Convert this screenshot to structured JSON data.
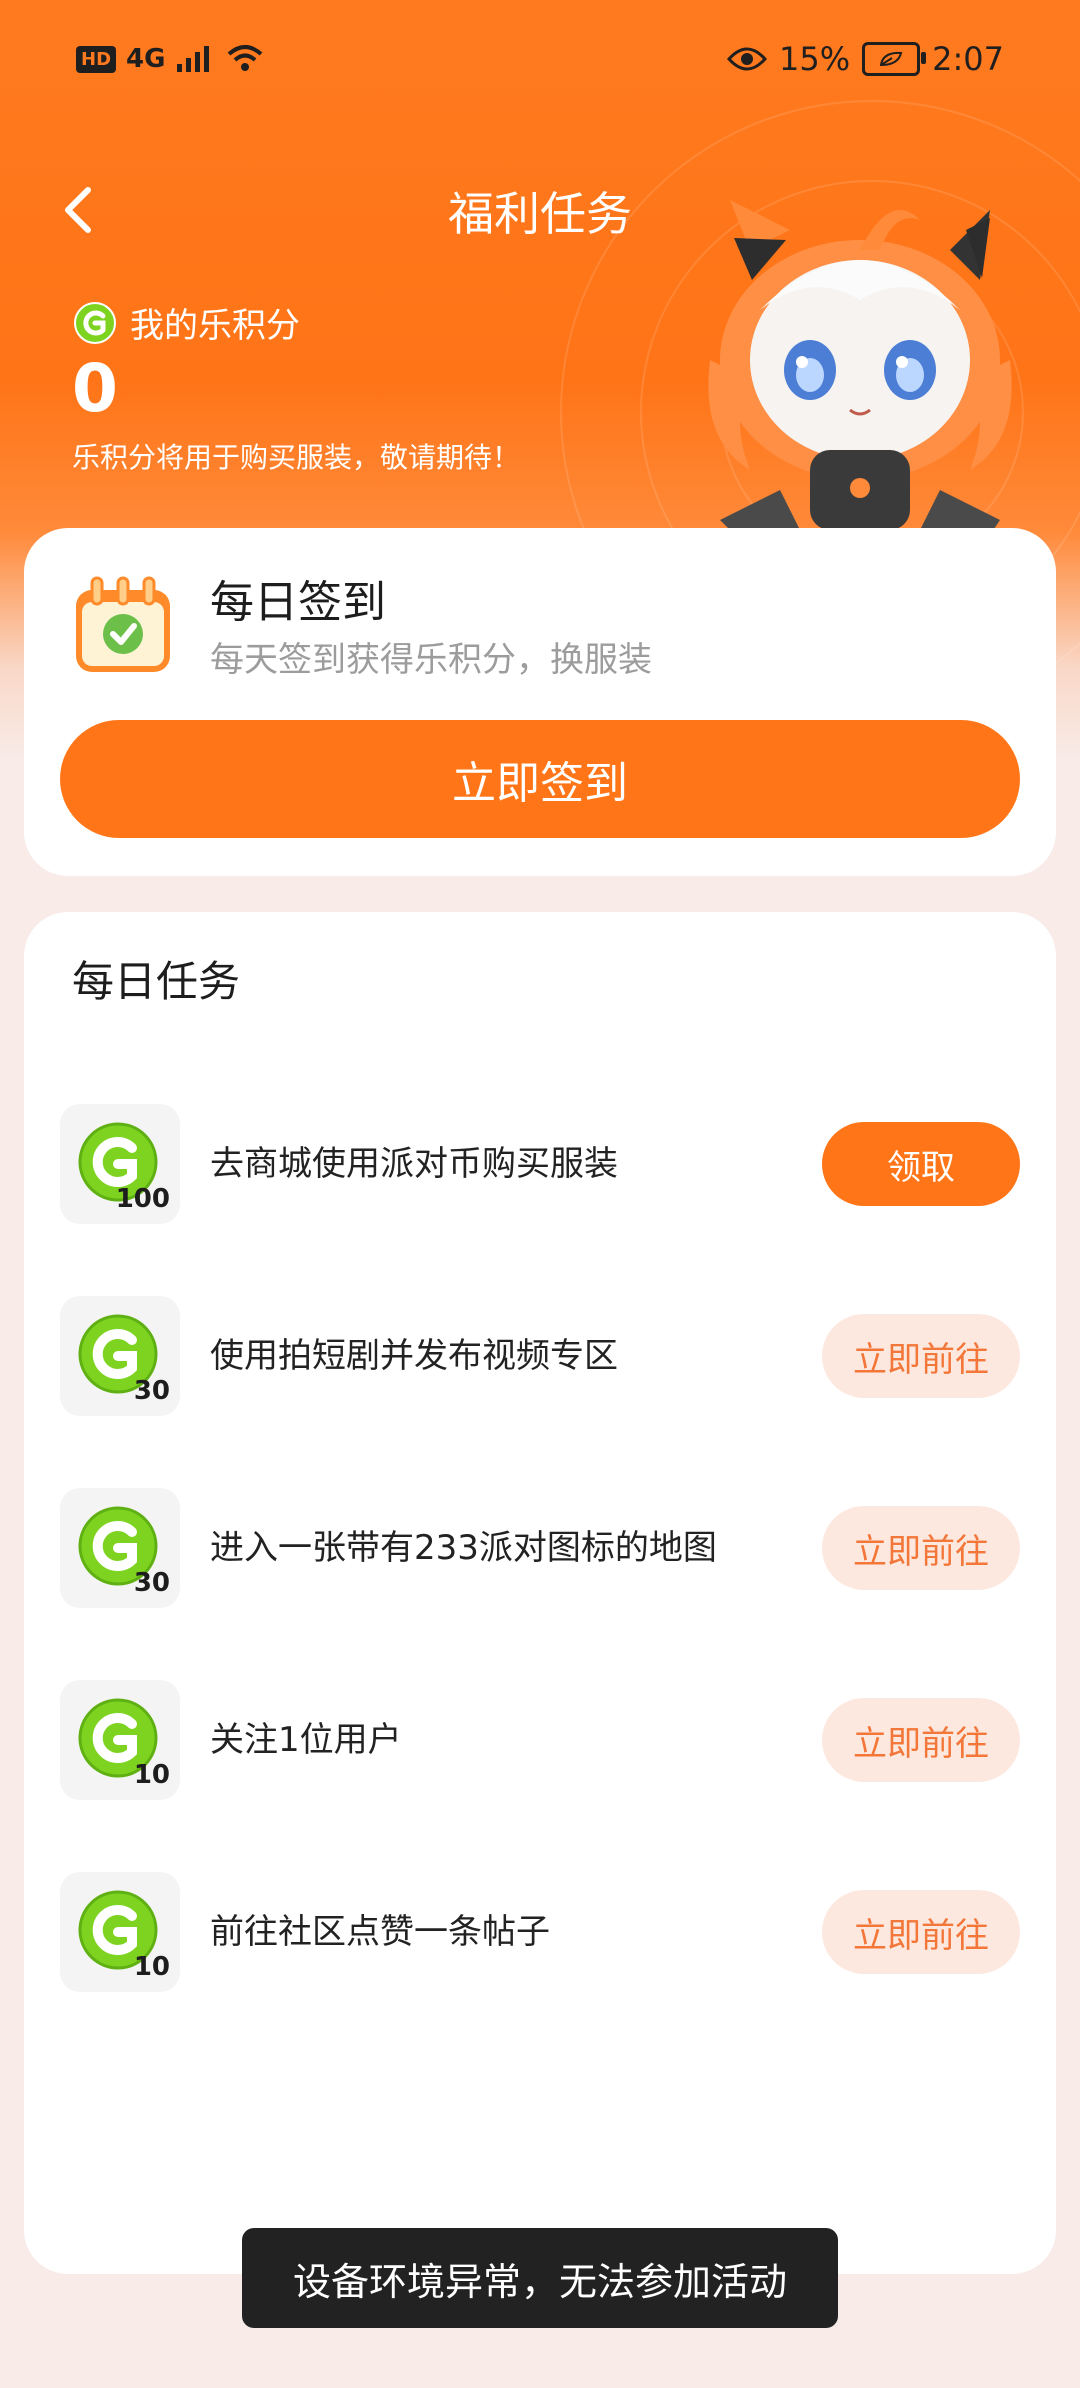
{
  "status_bar": {
    "network": "4G",
    "hd": "HD",
    "battery_percent": "15%",
    "time": "2:07"
  },
  "header": {
    "title": "福利任务"
  },
  "points": {
    "label": "我的乐积分",
    "value": "0",
    "note": "乐积分将用于购买服装，敬请期待！"
  },
  "signin": {
    "title": "每日签到",
    "subtitle": "每天签到获得乐积分，换服装",
    "button": "立即签到"
  },
  "tasks": {
    "title": "每日任务",
    "items": [
      {
        "reward": "100",
        "label": "去商城使用派对币购买服装",
        "button": "领取",
        "style": "primary"
      },
      {
        "reward": "30",
        "label": "使用拍短剧并发布视频专区",
        "button": "立即前往",
        "style": "secondary"
      },
      {
        "reward": "30",
        "label": "进入一张带有233派对图标的地图",
        "button": "立即前往",
        "style": "secondary"
      },
      {
        "reward": "10",
        "label": "关注1位用户",
        "button": "立即前往",
        "style": "secondary"
      },
      {
        "reward": "10",
        "label": "前往社区点赞一条帖子",
        "button": "立即前往",
        "style": "secondary"
      }
    ]
  },
  "toast": {
    "message": "设备环境异常，无法参加活动"
  },
  "colors": {
    "brand": "#ff7517",
    "secondary_button_bg": "#fde8df",
    "secondary_button_text": "#f4773a",
    "coin_green": "#7ed321"
  }
}
